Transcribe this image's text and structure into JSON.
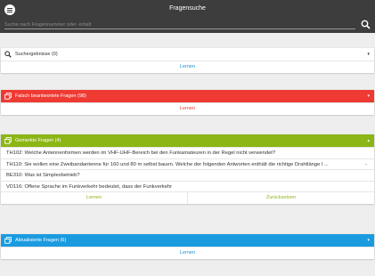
{
  "appbar": {
    "title": "Fragensuche",
    "search_placeholder": "Suche nach Fragennummer oder -inhalt",
    "background": "#3d3d3d"
  },
  "sections": {
    "search_results": {
      "title": "Suchergebnisse (0)",
      "caret": "▾",
      "learn_label": "Lernen",
      "link_color": "#1a8fd6"
    },
    "wrong": {
      "title": "Falsch beantwortete Fragen (98)",
      "caret": "▾",
      "learn_label": "Lernen",
      "color": "#ee3a33",
      "link_color": "#ee3a33"
    },
    "marked": {
      "title": "Gemerkte Fragen (4)",
      "caret": "▴",
      "color": "#8cb516",
      "questions": [
        {
          "text": "TH102: Welche Antennenformen werden im VHF-UHF-Bereich bei den Funkamateuren in der Regel nicht verwendet?",
          "trail": ""
        },
        {
          "text": "TH110: Sie wollen eine Zweibandantenne für 160 und 80 m selbst bauen.   Welche der folgenden Antworten enthält die richtige Drahtlänge l ...",
          "trail": "-"
        },
        {
          "text": "BE310: Was ist Simplexbetrieb?",
          "trail": ""
        },
        {
          "text": "VD116: Offene Sprache im Funkverkehr bedeutet, dass der Funkverkehr",
          "trail": ""
        }
      ],
      "learn_label": "Lernen",
      "reset_label": "Zurücksetzen",
      "link_color": "#8cb516"
    },
    "updated": {
      "title": "Aktualisierte Fragen (6)",
      "caret": "▾",
      "learn_label": "Lernen",
      "color": "#1a9be0",
      "link_color": "#1a8fd6"
    }
  }
}
